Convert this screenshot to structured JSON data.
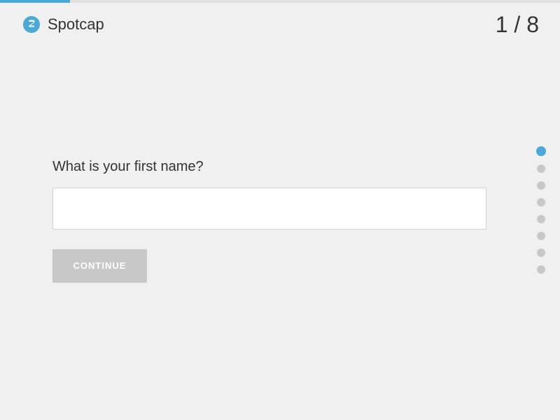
{
  "header": {
    "logo_text": "Spotcap",
    "step_counter": "1 / 8"
  },
  "progress": {
    "fill_percent": 12.5
  },
  "form": {
    "question": "What is your first name?",
    "input_placeholder": "",
    "continue_label": "CONTINUE"
  },
  "steps": {
    "total": 8,
    "current": 1,
    "dots": [
      {
        "id": 1,
        "active": true
      },
      {
        "id": 2,
        "active": false
      },
      {
        "id": 3,
        "active": false
      },
      {
        "id": 4,
        "active": false
      },
      {
        "id": 5,
        "active": false
      },
      {
        "id": 6,
        "active": false
      },
      {
        "id": 7,
        "active": false
      },
      {
        "id": 8,
        "active": false
      }
    ]
  },
  "colors": {
    "accent": "#4aa9d5",
    "button_inactive": "#c8c8c8",
    "dot_inactive": "#c8c8c8",
    "background": "#f0f0f0"
  }
}
